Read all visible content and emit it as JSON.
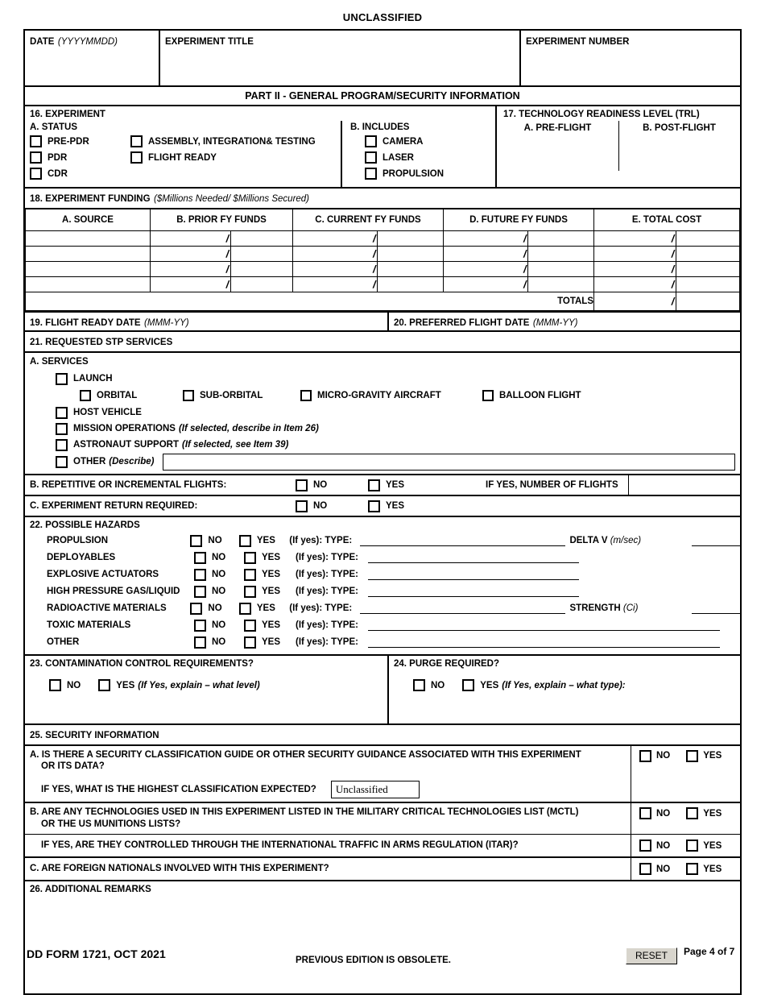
{
  "classification_header": "UNCLASSIFIED",
  "identification": {
    "date_label": "DATE",
    "date_hint": "(YYYYMMDD)",
    "title_label": "EXPERIMENT TITLE",
    "number_label": "EXPERIMENT NUMBER",
    "date_value": "",
    "title_value": "",
    "number_value": ""
  },
  "part_title": "PART II - GENERAL PROGRAM/SECURITY INFORMATION",
  "item16": {
    "heading": "16. EXPERIMENT",
    "status_heading": "A. STATUS",
    "status_col1": [
      "PRE-PDR",
      "PDR",
      "CDR"
    ],
    "status_col2": [
      "ASSEMBLY, INTEGRATION& TESTING",
      "FLIGHT READY"
    ],
    "includes_heading": "B. INCLUDES",
    "includes": [
      "CAMERA",
      "LASER",
      "PROPULSION"
    ]
  },
  "item17": {
    "heading": "17. TECHNOLOGY READINESS LEVEL (TRL)",
    "pre_flight_label": "A. PRE-FLIGHT",
    "post_flight_label": "B. POST-FLIGHT",
    "pre_flight_value": "",
    "post_flight_value": ""
  },
  "item18": {
    "heading": "18. EXPERIMENT FUNDING",
    "heading_hint": "($Millions Needed/ $Millions Secured)",
    "columns": [
      "A. SOURCE",
      "B. PRIOR FY FUNDS",
      "C. CURRENT FY FUNDS",
      "D. FUTURE FY FUNDS",
      "E. TOTAL COST"
    ],
    "slash": "/",
    "rows": [
      {
        "source": "",
        "prior_needed": "",
        "prior_secured": "",
        "current_needed": "",
        "current_secured": "",
        "future_needed": "",
        "future_secured": "",
        "total_needed": "",
        "total_secured": ""
      },
      {
        "source": "",
        "prior_needed": "",
        "prior_secured": "",
        "current_needed": "",
        "current_secured": "",
        "future_needed": "",
        "future_secured": "",
        "total_needed": "",
        "total_secured": ""
      },
      {
        "source": "",
        "prior_needed": "",
        "prior_secured": "",
        "current_needed": "",
        "current_secured": "",
        "future_needed": "",
        "future_secured": "",
        "total_needed": "",
        "total_secured": ""
      },
      {
        "source": "",
        "prior_needed": "",
        "prior_secured": "",
        "current_needed": "",
        "current_secured": "",
        "future_needed": "",
        "future_secured": "",
        "total_needed": "",
        "total_secured": ""
      }
    ],
    "totals_label": "TOTALS",
    "totals_needed": "",
    "totals_secured": ""
  },
  "item19": {
    "label": "19. FLIGHT READY DATE",
    "hint": "(MMM-YY)",
    "value": ""
  },
  "item20": {
    "label": "20. PREFERRED FLIGHT DATE",
    "hint": "(MMM-YY)",
    "value": ""
  },
  "item21": {
    "heading": "21. REQUESTED STP SERVICES",
    "services_heading": "A. SERVICES",
    "launch": "LAUNCH",
    "launch_types": [
      "ORBITAL",
      "SUB-ORBITAL",
      "MICRO-GRAVITY AIRCRAFT",
      "BALLOON FLIGHT"
    ],
    "host_vehicle": "HOST VEHICLE",
    "mission_ops": "MISSION OPERATIONS",
    "mission_ops_hint": "(If selected, describe in Item 26)",
    "astronaut_support": "ASTRONAUT SUPPORT",
    "astronaut_support_hint": "(If selected, see Item 39)",
    "other": "OTHER",
    "other_hint": "(Describe)",
    "other_value": "",
    "b_label": "B. REPETITIVE OR INCREMENTAL FLIGHTS:",
    "b_no": "NO",
    "b_yes": "YES",
    "b_if_yes": "IF YES, NUMBER OF FLIGHTS",
    "b_flights_value": "",
    "c_label": "C. EXPERIMENT RETURN REQUIRED:",
    "c_no": "NO",
    "c_yes": "YES"
  },
  "item22": {
    "heading": "22. POSSIBLE HAZARDS",
    "no": "NO",
    "yes": "YES",
    "if_yes_type": "(If yes): TYPE:",
    "delta_v_label": "DELTA V",
    "delta_v_hint": "(m/sec)",
    "delta_v_value": "",
    "strength_label": "STRENGTH",
    "strength_hint": "(Ci)",
    "strength_value": "",
    "hazards": [
      {
        "name": "PROPULSION",
        "type_value": "",
        "extra": "delta_v"
      },
      {
        "name": "DEPLOYABLES",
        "type_value": "",
        "extra": ""
      },
      {
        "name": "EXPLOSIVE ACTUATORS",
        "type_value": "",
        "extra": ""
      },
      {
        "name": "HIGH PRESSURE GAS/LIQUID",
        "type_value": "",
        "extra": ""
      },
      {
        "name": "RADIOACTIVE MATERIALS",
        "type_value": "",
        "extra": "strength"
      },
      {
        "name": "TOXIC MATERIALS",
        "type_value": "",
        "extra": "wide"
      },
      {
        "name": "OTHER",
        "type_value": "",
        "extra": "wide"
      }
    ]
  },
  "item23": {
    "heading": "23. CONTAMINATION CONTROL REQUIREMENTS?",
    "no": "NO",
    "yes": "YES",
    "yes_hint": "(If Yes, explain – what level)",
    "value": ""
  },
  "item24": {
    "heading": "24. PURGE REQUIRED?",
    "no": "NO",
    "yes": "YES",
    "yes_hint": "(If Yes, explain – what type):",
    "value": ""
  },
  "item25": {
    "heading": "25. SECURITY INFORMATION",
    "no": "NO",
    "yes": "YES",
    "a_line1": "A. IS THERE A SECURITY CLASSIFICATION GUIDE OR OTHER SECURITY GUIDANCE ASSOCIATED WITH THIS EXPERIMENT",
    "a_line2": "OR ITS DATA?",
    "a_class_question": "IF YES, WHAT IS THE HIGHEST CLASSIFICATION EXPECTED?",
    "a_class_value": "Unclassified",
    "b_line1": "B. ARE ANY TECHNOLOGIES USED IN THIS EXPERIMENT LISTED IN THE MILITARY CRITICAL TECHNOLOGIES LIST (MCTL)",
    "b_line2": "OR THE US MUNITIONS LISTS?",
    "b_itar": "IF YES, ARE THEY CONTROLLED THROUGH THE INTERNATIONAL TRAFFIC IN ARMS REGULATION (ITAR)?",
    "c_line": "C. ARE FOREIGN NATIONALS INVOLVED WITH THIS EXPERIMENT?"
  },
  "item26": {
    "heading": "26. ADDITIONAL REMARKS",
    "value": ""
  },
  "footer": {
    "form_id": "DD FORM 1721, OCT 2021",
    "previous_edition": "PREVIOUS EDITION IS OBSOLETE.",
    "reset_label": "RESET",
    "page_label": "Page 4 of 7"
  }
}
